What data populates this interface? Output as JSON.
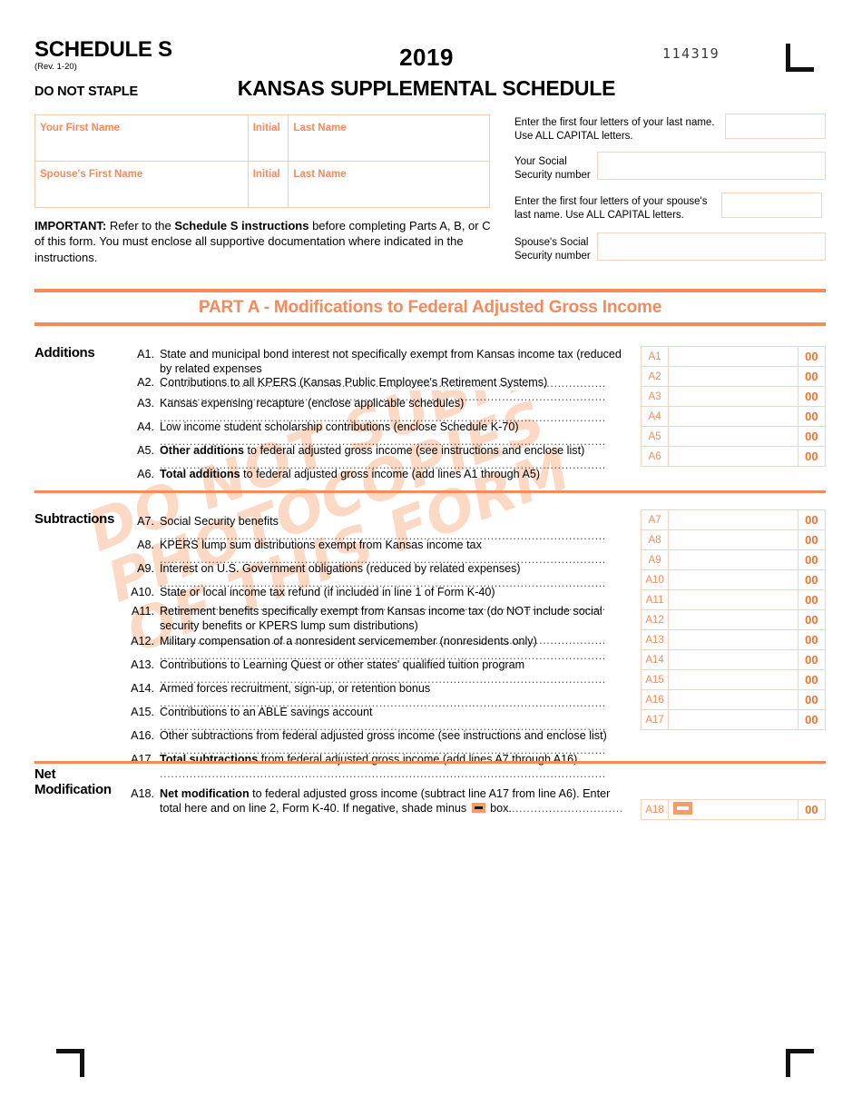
{
  "header": {
    "schedule_title": "SCHEDULE S",
    "revision": "(Rev. 1-20)",
    "do_not_staple": "DO NOT STAPLE",
    "year": "2019",
    "form_name": "KANSAS SUPPLEMENTAL SCHEDULE",
    "form_number": "114319"
  },
  "watermark": "DO NOT SUBMIT\nPHOTOCOPIES\nOF THIS FORM",
  "name_table": {
    "your_first_name": "Your First Name",
    "initial": "Initial",
    "last_name": "Last Name",
    "spouse_first_name": "Spouse's First Name",
    "spouse_initial": "Initial",
    "spouse_last_name": "Last Name"
  },
  "important": {
    "label": "IMPORTANT:",
    "text_1": " Refer to the ",
    "bold_ref": "Schedule S instructions",
    "text_2": " before completing Parts A, B, or C of this form. You must enclose all supportive documentation where indicated in the instructions."
  },
  "identity": {
    "your_last_name_letters": "Enter the first four letters of your last name. Use ALL CAPITAL letters.",
    "your_ssn": "Your Social\nSecurity number",
    "spouse_last_name_letters": "Enter the first four letters of your spouse's last name. Use ALL CAPITAL letters.",
    "spouse_ssn": "Spouse's Social\nSecurity number"
  },
  "part_a": {
    "banner_title": "PART A - Modifications to Federal Adjusted Gross Income",
    "additions_heading": "Additions",
    "subtractions_heading": "Subtractions",
    "net_modification_heading": "Net\nModification"
  },
  "cents": "00",
  "additions": [
    {
      "code": "A1",
      "num": "A1.",
      "text": "State and municipal bond interest not specifically exempt from Kansas income tax (reduced by related expenses",
      "bold_lead": "",
      "two_line": true
    },
    {
      "code": "A2",
      "num": "A2.",
      "text": "Contributions to all KPERS (Kansas Public Employee's Retirement Systems)",
      "bold_lead": ""
    },
    {
      "code": "A3",
      "num": "A3.",
      "text": "Kansas expensing recapture (enclose applicable schedules)",
      "bold_lead": ""
    },
    {
      "code": "A4",
      "num": "A4.",
      "text": "Low income student scholarship contributions (enclose Schedule K-70)",
      "bold_lead": ""
    },
    {
      "code": "A5",
      "num": "A5.",
      "bold_lead": "Other additions",
      "text": " to federal adjusted gross income (see instructions and enclose list)"
    },
    {
      "code": "A6",
      "num": "A6.",
      "bold_lead": "Total additions",
      "text": " to federal adjusted gross income (add lines A1 through A5)"
    }
  ],
  "subtractions": [
    {
      "code": "A7",
      "num": "A7.",
      "bold_lead": "",
      "text": "Social Security benefits"
    },
    {
      "code": "A8",
      "num": "A8.",
      "bold_lead": "",
      "text": "KPERS lump sum distributions exempt from Kansas income tax"
    },
    {
      "code": "A9",
      "num": "A9.",
      "bold_lead": "",
      "text": "Interest on U.S. Government obligations (reduced by related expenses)"
    },
    {
      "code": "A10",
      "num": "A10.",
      "bold_lead": "",
      "text": "State or local income tax refund (if included in line 1 of Form K-40)"
    },
    {
      "code": "A11",
      "num": "A11.",
      "bold_lead": "",
      "text": "Retirement benefits specifically exempt from Kansas income tax (do NOT include social security benefits or KPERS lump sum distributions)",
      "two_line": true
    },
    {
      "code": "A12",
      "num": "A12.",
      "bold_lead": "",
      "text": "Military compensation of a nonresident servicemember (nonresidents only)"
    },
    {
      "code": "A13",
      "num": "A13.",
      "bold_lead": "",
      "text": "Contributions to Learning Quest or other states' qualified tuition program"
    },
    {
      "code": "A14",
      "num": "A14.",
      "bold_lead": "",
      "text": "Armed forces recruitment, sign-up, or retention bonus"
    },
    {
      "code": "A15",
      "num": "A15.",
      "bold_lead": "",
      "text": "Contributions to an ABLE savings account"
    },
    {
      "code": "A16",
      "num": "A16.",
      "bold_lead": "",
      "text": "Other subtractions from federal adjusted gross income (see instructions and enclose list)"
    },
    {
      "code": "A17",
      "num": "A17.",
      "bold_lead": "Total subtractions",
      "text": " from federal adjusted gross income (add lines A7 through A16)"
    }
  ],
  "net_modification": {
    "code": "A18",
    "num": "A18.",
    "bold_lead": "Net modification",
    "text_1": " to federal adjusted gross income (subtract line A17 from line A6). Enter total here and on line 2, Form K-40. If negative, shade minus ",
    "text_2": " box."
  },
  "colors": {
    "accent": "#f58a5a",
    "box_border": "#f7d3bd",
    "cents": "#f0742f",
    "watermark": "#fbd9c4"
  }
}
